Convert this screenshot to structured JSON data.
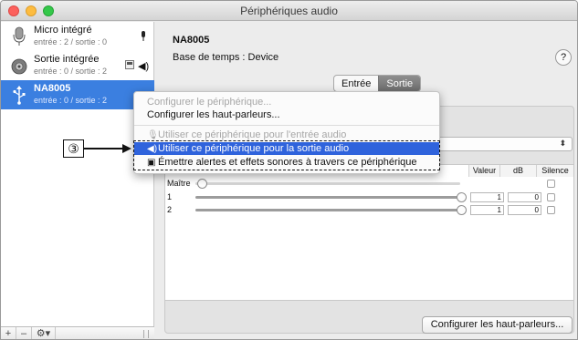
{
  "window": {
    "title": "Périphériques audio"
  },
  "sidebar": {
    "devices": [
      {
        "name": "Micro intégré",
        "sub": "entrée : 2 / sortie : 0",
        "icon": "microphone-icon"
      },
      {
        "name": "Sortie intégrée",
        "sub": "entrée : 0 / sortie : 2",
        "icon": "speaker-icon"
      },
      {
        "name": "NA8005",
        "sub": "entrée : 0 / sortie : 2",
        "icon": "usb-icon"
      }
    ],
    "bottom": {
      "add": "+",
      "remove": "–",
      "gear": "⚙▾"
    }
  },
  "main": {
    "device_title": "NA8005",
    "clock": "Base de temps : Device",
    "help": "?",
    "tabs": [
      "Entrée",
      "Sortie"
    ],
    "active_tab": "Sortie",
    "table": {
      "headers": {
        "value": "Valeur",
        "db": "dB",
        "mute": "Silence"
      },
      "rows": [
        {
          "label": "Maître",
          "value": "",
          "db": ""
        },
        {
          "label": "1",
          "value": "1",
          "db": "0"
        },
        {
          "label": "2",
          "value": "1",
          "db": "0"
        }
      ]
    },
    "configure_button": "Configurer les haut-parleurs..."
  },
  "context_menu": {
    "items": [
      {
        "label": "Configurer le périphérique...",
        "state": "disabled"
      },
      {
        "label": "Configurer les haut-parleurs...",
        "state": "normal"
      },
      {
        "label": "Utiliser ce périphérique pour l'entrée audio",
        "state": "disabled"
      },
      {
        "label": "Utiliser ce périphérique pour la sortie audio",
        "state": "highlighted"
      },
      {
        "label": "Émettre alertes et effets sonores à travers ce périphérique",
        "state": "normal"
      }
    ]
  },
  "callout": {
    "label": "③"
  },
  "colors": {
    "selection": "#3b7fe0",
    "menu_highlight": "#2f63dc"
  }
}
